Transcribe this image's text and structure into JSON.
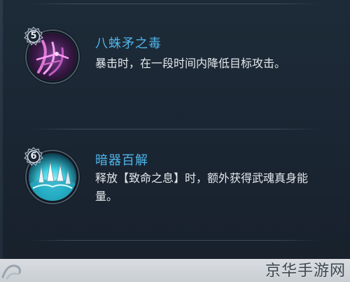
{
  "skills": [
    {
      "level": "5",
      "title": "八蛛矛之毒",
      "description": "暴击时，在一段时间内降低目标攻击。",
      "icon": "spider-spear-icon"
    },
    {
      "level": "6",
      "title": "暗器百解",
      "description": "释放【致命之息】时，额外获得武魂真身能量。",
      "icon": "hidden-weapon-burst-icon"
    }
  ],
  "watermark": "京华手游网",
  "colors": {
    "title": "#4fb4ea",
    "description": "#e4e8ec",
    "panel": "#1d2b38"
  }
}
